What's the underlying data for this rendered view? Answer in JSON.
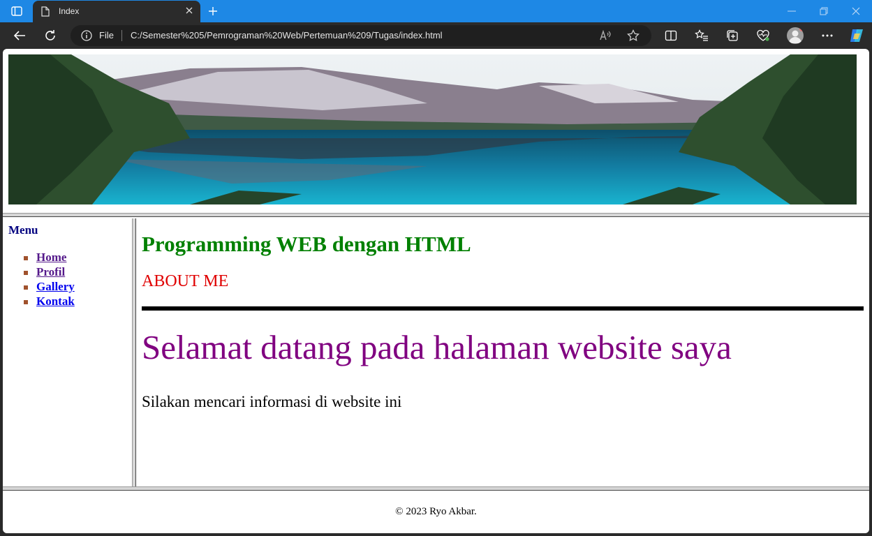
{
  "browser": {
    "tab_title": "Index",
    "address": {
      "scheme_label": "File",
      "url": "C:/Semester%205/Pemrograman%20Web/Pertemuan%209/Tugas/index.html"
    },
    "accent_color": "#1e88e5"
  },
  "page": {
    "menu": {
      "title": "Menu",
      "items": [
        {
          "label": "Home",
          "color": "#551a8b"
        },
        {
          "label": "Profil",
          "color": "#551a8b"
        },
        {
          "label": "Gallery",
          "color": "#0000ee"
        },
        {
          "label": "Kontak",
          "color": "#0000ee"
        }
      ]
    },
    "main": {
      "heading": "Programming WEB dengan HTML",
      "subheading": "ABOUT ME",
      "welcome": "Selamat datang pada halaman website saya",
      "paragraph": "Silakan mencari informasi di website ini"
    },
    "footer": {
      "text": "© 2023 Ryo Akbar."
    }
  }
}
